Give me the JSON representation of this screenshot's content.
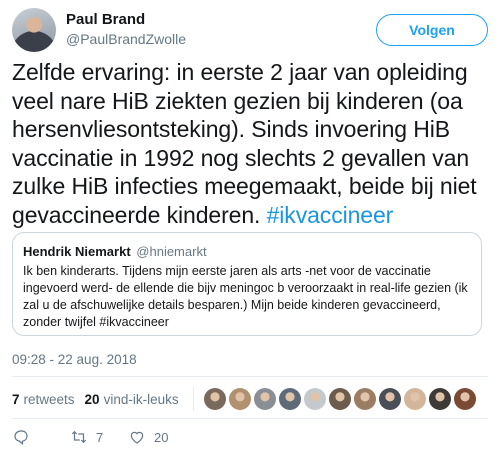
{
  "author": {
    "name": "Paul Brand",
    "handle": "@PaulBrandZwolle",
    "avatar_icon": "avatar-photo"
  },
  "follow_label": "Volgen",
  "tweet": {
    "text": "Zelfde ervaring: in eerste 2 jaar van opleiding veel nare HiB ziekten gezien bij kinderen (oa hersenvliesontsteking). Sinds invoering HiB vaccinatie in 1992 nog slechts 2 gevallen van zulke HiB infecties meegemaakt, beide bij niet gevaccineerde kinderen.",
    "hashtag": "#ikvaccineer"
  },
  "quote": {
    "name": "Hendrik Niemarkt",
    "handle": "@hniemarkt",
    "text": "Ik ben kinderarts. Tijdens mijn eerste jaren als arts -net voor de vaccinatie ingevoerd werd- de ellende die bijv meningoc b veroorzaakt in real-life gezien (ik zal u de afschuwelijke details besparen.) Mijn beide kinderen gevaccineerd, zonder twijfel #ikvaccineer"
  },
  "timestamp": "09:28 - 22 aug. 2018",
  "stats": {
    "retweets_count": "7",
    "retweets_label": "retweets",
    "likes_count": "20",
    "likes_label": "vind-ik-leuks"
  },
  "liker_avatars": [
    "#7a6a5c",
    "#b0906f",
    "#8a8f96",
    "#5e6a78",
    "#c4c9ce",
    "#6d5b4c",
    "#9b7d63",
    "#4a4f57",
    "#d3b69a",
    "#3d3a38",
    "#7b4a34"
  ],
  "actions": {
    "reply_count": "",
    "retweet_count": "7",
    "like_count": "20"
  }
}
